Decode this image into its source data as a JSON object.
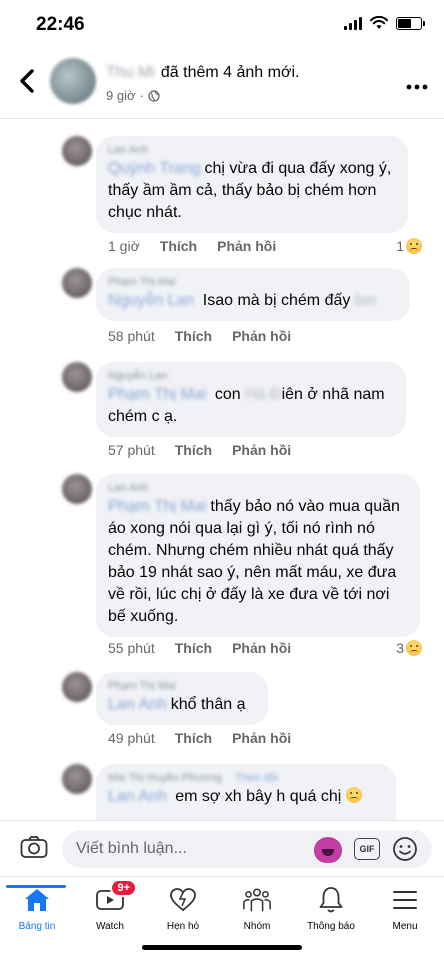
{
  "status_bar": {
    "time": "22:46"
  },
  "post_header": {
    "author": "Thu Mi",
    "action": "đã thêm 4 ảnh mới.",
    "time": "9 giờ",
    "separator": "·"
  },
  "comments": [
    {
      "author": "Lan Anh",
      "mention": "Quỳnh Trang",
      "text": "chị vừa đi qua đấy xong ý, thấy ầm ầm cả, thấy bảo bị chém hơn chục nhát.",
      "time": "1 giờ",
      "like": "Thích",
      "reply": "Phản hồi",
      "reaction_count": "1"
    },
    {
      "author": "Phạm Thị Mai",
      "mention": "Nguyễn Lan",
      "text": "Isao mà bị chém đấy",
      "redacted": "lan",
      "time": "58 phút",
      "like": "Thích",
      "reply": "Phản hồi"
    },
    {
      "author": "Nguyễn Lan",
      "mention": "Phạm Thị Mai",
      "text_a": "con",
      "redacted": "Hà Đ",
      "text_b": "iên ở nhã nam chém c ạ.",
      "time": "57 phút",
      "like": "Thích",
      "reply": "Phản hồi"
    },
    {
      "author": "Lan Anh",
      "mention": "Phạm Thị Mai",
      "text": "thấy bảo nó vào mua quần áo xong nói qua lại gì ý, tối nó rình nó chém. Nhưng chém nhiều nhát quá thấy bảo 19 nhát sao ý, nên mất máu, xe đưa về rồi, lúc chị ở đấy là xe đưa về tới nơi bế xuống.",
      "time": "55 phút",
      "like": "Thích",
      "reply": "Phản hồi",
      "reaction_count": "3"
    },
    {
      "author": "Phạm Thị Mai",
      "mention": "Lan Anh",
      "text": "khổ thân ạ",
      "time": "49 phút",
      "like": "Thích",
      "reply": "Phản hồi"
    },
    {
      "author": "Mai Thị Huyền Phương",
      "author_tag": "Theo dõi",
      "mention": "Lan Anh",
      "text": "em sợ xh bây h quá chị"
    }
  ],
  "composer": {
    "placeholder": "Viết bình luận...",
    "gif_label": "GIF"
  },
  "tabs": [
    {
      "label": "Bảng tin",
      "icon": "home-icon",
      "active": true
    },
    {
      "label": "Watch",
      "icon": "watch-icon",
      "badge": "9+"
    },
    {
      "label": "Hẹn hò",
      "icon": "dating-heart-icon"
    },
    {
      "label": "Nhóm",
      "icon": "groups-icon"
    },
    {
      "label": "Thông báo",
      "icon": "bell-icon"
    },
    {
      "label": "Menu",
      "icon": "menu-icon"
    }
  ],
  "colors": {
    "accent": "#1877f2",
    "bubble": "#f0f2f5",
    "secondary_text": "#65676b",
    "badge": "#e41e3f"
  }
}
